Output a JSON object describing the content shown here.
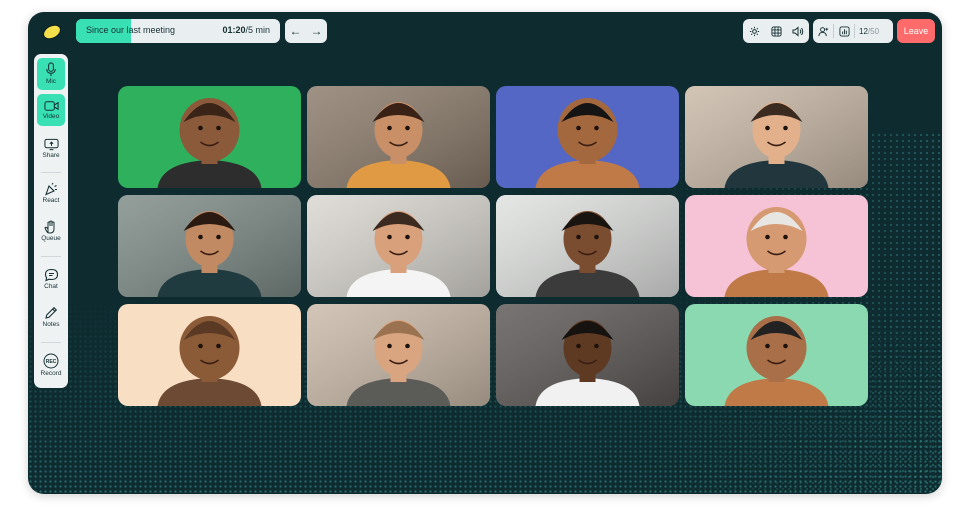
{
  "timer": {
    "label": "Since our last meeting",
    "elapsed": "01:20",
    "separator": "/",
    "total": "5 min",
    "progress": 0.27
  },
  "participant_count": {
    "current": "12",
    "max": "/50"
  },
  "leave_label": "Leave",
  "colors": {
    "bg": "#0e2b30",
    "accent": "#39e0b4",
    "leave": "#ff6b6b",
    "panel": "#e9eef0"
  },
  "sidebar": {
    "items": [
      {
        "label": "Mic",
        "icon": "mic-icon",
        "active": true
      },
      {
        "label": "Video",
        "icon": "video-icon",
        "active": true
      },
      {
        "label": "Share",
        "icon": "share-screen-icon",
        "active": false
      },
      {
        "label": "React",
        "icon": "party-popper-icon",
        "active": false
      },
      {
        "label": "Queue",
        "icon": "raise-hand-icon",
        "active": false
      },
      {
        "label": "Chat",
        "icon": "chat-icon",
        "active": false
      },
      {
        "label": "Notes",
        "icon": "pencil-icon",
        "active": false
      },
      {
        "label": "Record",
        "icon": "record-icon",
        "active": false
      }
    ]
  },
  "toolbar_icons": [
    "settings-icon",
    "grid-layout-icon",
    "sound-icon",
    "add-person-icon",
    "stats-icon"
  ],
  "participants": [
    {
      "kind": "avatar",
      "bg": "#2fb05c"
    },
    {
      "kind": "video",
      "bg": "#8a7a6a"
    },
    {
      "kind": "avatar",
      "bg": "#5567c4"
    },
    {
      "kind": "video",
      "bg": "#c8b8a6"
    },
    {
      "kind": "video",
      "bg": "#7c8a86"
    },
    {
      "kind": "video",
      "bg": "#d9d6cf"
    },
    {
      "kind": "video",
      "bg": "#dfe1df"
    },
    {
      "kind": "avatar",
      "bg": "#f6c2d6"
    },
    {
      "kind": "avatar",
      "bg": "#f8dfc4"
    },
    {
      "kind": "video",
      "bg": "#c9b9a8"
    },
    {
      "kind": "video",
      "bg": "#5b5654"
    },
    {
      "kind": "avatar",
      "bg": "#8ad9b0"
    }
  ]
}
